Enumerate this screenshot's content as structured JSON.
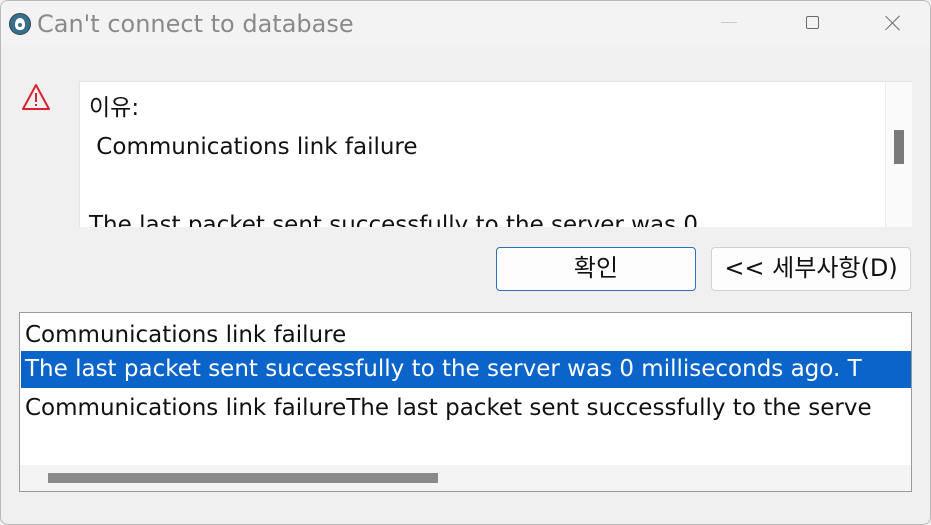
{
  "window": {
    "title": "Can't connect to database",
    "controls": [
      "minimize-icon",
      "maximize-icon",
      "close-icon"
    ]
  },
  "message": {
    "icon": "warning-icon",
    "text": "이유:\n Communications link failure\n\nThe last packet sent successfully to the server was 0"
  },
  "buttons": {
    "ok_label": "확인",
    "details_label": "<< 세부사항(D)"
  },
  "details": {
    "rows": [
      "Communications link failure",
      "The last packet sent successfully to the server was 0 milliseconds ago. T",
      "Communications link failureThe last packet sent successfully to the serve"
    ],
    "selected_row": 1
  },
  "colors": {
    "selection": "#0a64c9",
    "ok_border": "#2d6fbf",
    "warning": "#d9232f"
  }
}
